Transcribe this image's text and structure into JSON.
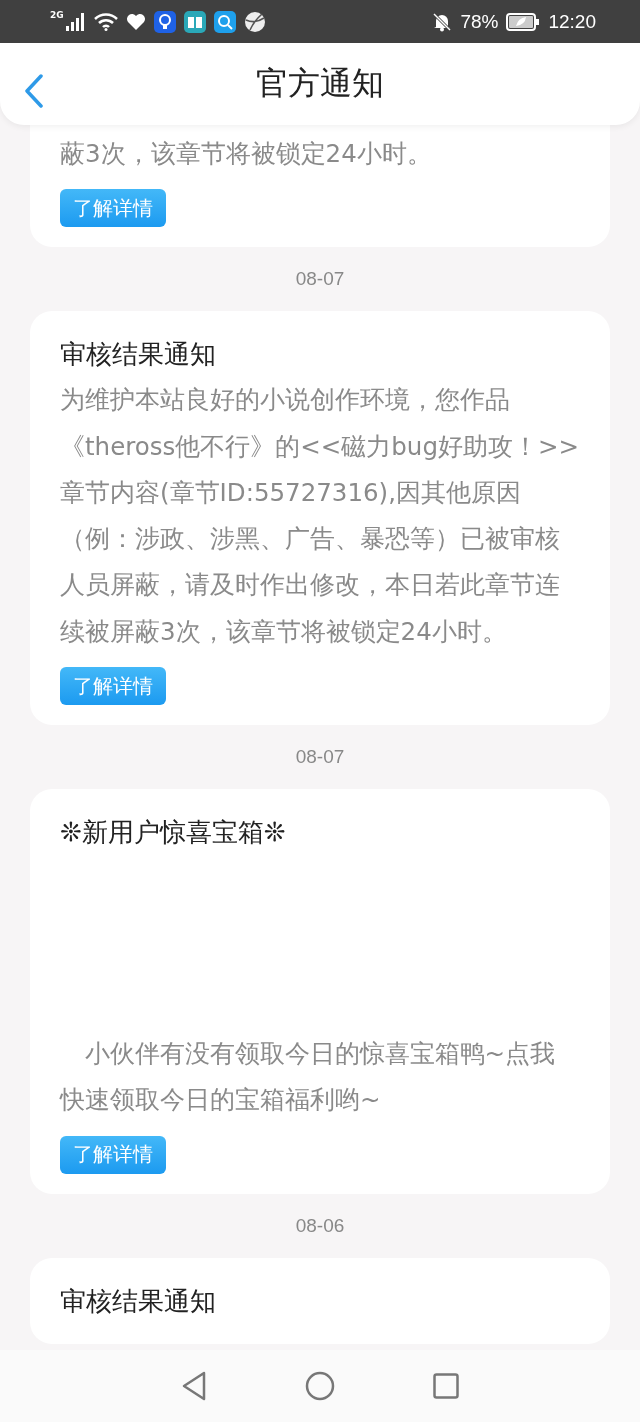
{
  "status_bar": {
    "network": "2G",
    "battery": "78%",
    "time": "12:20"
  },
  "header": {
    "title": "官方通知"
  },
  "feed": [
    {
      "kind": "continued_card",
      "body": "蔽3次，该章节将被锁定24小时。",
      "button": "了解详情"
    },
    {
      "kind": "date",
      "text": "08-07"
    },
    {
      "kind": "card",
      "title": "审核结果通知",
      "body": "为维护本站良好的小说创作环境，您作品《theross他不行》的<<磁力bug好助攻！>>章节内容(章节ID:55727316),因其他原因（例：涉政、涉黑、广告、暴恐等）已被审核人员屏蔽，请及时作出修改，本日若此章节连续被屏蔽3次，该章节将被锁定24小时。",
      "button": "了解详情"
    },
    {
      "kind": "date",
      "text": "08-07"
    },
    {
      "kind": "card",
      "title": "❊新用户惊喜宝箱❊",
      "blank_media": true,
      "indented": true,
      "body": "小伙伴有没有领取今日的惊喜宝箱鸭~点我快速领取今日的宝箱福利哟~",
      "button": "了解详情"
    },
    {
      "kind": "date",
      "text": "08-06"
    },
    {
      "kind": "card",
      "title": "审核结果通知"
    }
  ]
}
